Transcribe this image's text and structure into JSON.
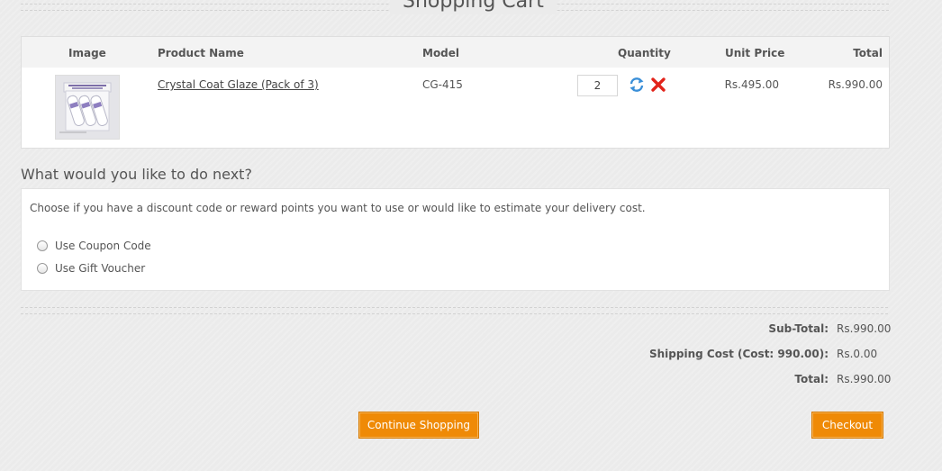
{
  "page_title": "Shopping Cart",
  "cart": {
    "headers": {
      "image": "Image",
      "product_name": "Product Name",
      "model": "Model",
      "quantity": "Quantity",
      "unit_price": "Unit Price",
      "total": "Total"
    },
    "items": [
      {
        "image_icon": "product-thumbnail",
        "product_name": "Crystal Coat Glaze (Pack of 3)",
        "model": "CG-415",
        "quantity": "2",
        "unit_price": "Rs.495.00",
        "total": "Rs.990.00"
      }
    ],
    "icons": {
      "update": "refresh-icon",
      "remove": "remove-icon"
    },
    "colors": {
      "update": "#3a8fd8",
      "remove": "#e2231a"
    }
  },
  "next": {
    "title": "What would you like to do next?",
    "description": "Choose if you have a discount code or reward points you want to use or would like to estimate your delivery cost.",
    "options": [
      {
        "label": "Use Coupon Code"
      },
      {
        "label": "Use Gift Voucher"
      }
    ]
  },
  "totals": [
    {
      "label": "Sub-Total:",
      "value": "Rs.990.00"
    },
    {
      "label": "Shipping Cost (Cost: 990.00):",
      "value": "Rs.0.00"
    },
    {
      "label": "Total:",
      "value": "Rs.990.00"
    }
  ],
  "buttons": {
    "continue_label": "Continue Shopping",
    "checkout_label": "Checkout"
  },
  "colors": {
    "accent": "#ef8a06"
  }
}
